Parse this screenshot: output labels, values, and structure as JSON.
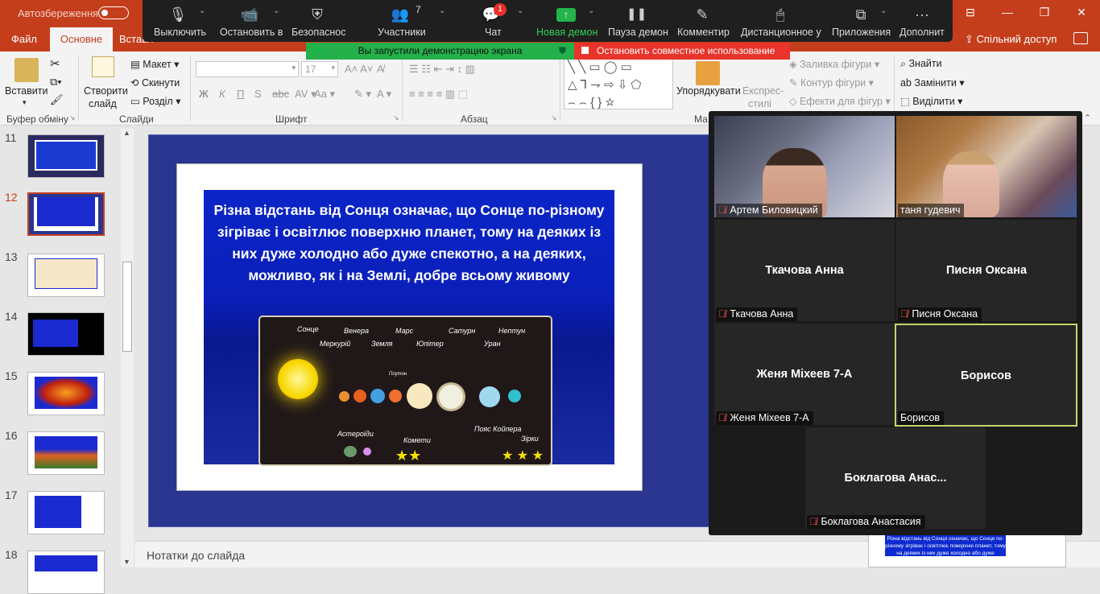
{
  "titlebar": {
    "autosave_label": "Автозбереження"
  },
  "tabs": {
    "file": "Файл",
    "home": "Основне",
    "insert": "Вставл",
    "share": "Спільний доступ"
  },
  "ribbon": {
    "paste": "Вставити",
    "new_slide_1": "Створити",
    "new_slide_2": "слайд",
    "layout": "Макет",
    "reset": "Скинути",
    "section": "Розділ",
    "font_size": "17",
    "arrange": "Упорядкувати",
    "quick_styles_1": "Експрес-",
    "quick_styles_2": "стилі",
    "shape_fill": "Заливка фігури",
    "shape_outline": "Контур фігури",
    "shape_effects": "Ефекти для фігур",
    "find": "Знайти",
    "replace": "Замінити",
    "select": "Виділити",
    "groups": {
      "clipboard": "Буфер обміну",
      "slides": "Слайди",
      "font": "Шрифт",
      "paragraph": "Абзац",
      "drawing": "Ма"
    }
  },
  "zoom": {
    "mute": "Выключить",
    "video": "Остановить в",
    "security": "Безопаснос",
    "participants": "Участники",
    "participants_count": "7",
    "chat": "Чат",
    "chat_badge": "1",
    "new_share": "Новая демон",
    "pause": "Пауза демон",
    "annotate": "Комментир",
    "remote": "Дистанционное у",
    "apps": "Приложения",
    "more": "Дополнит",
    "banner_sharing": "Вы запустили демонстрацию экрана",
    "banner_stop": "Остановить совместное использование"
  },
  "thumbnails": [
    "11",
    "12",
    "13",
    "14",
    "15",
    "16",
    "17",
    "18"
  ],
  "slide": {
    "text": "Різна відстань від Сонця означає, що Сонце по-різному зігріває і освітлює поверхню планет, тому на деяких із них дуже холодно або дуже спекотно, а на деяких, можливо, як і на Землі, добре всьому живому",
    "planets": [
      "Сонце",
      "Венера",
      "Меркурій",
      "Земля",
      "Марс",
      "Юпітер",
      "Сатурн",
      "Уран",
      "Нептун",
      "Плутон",
      "Астероїди",
      "Комети",
      "Пояс Койпера",
      "Зірки"
    ]
  },
  "notes": {
    "label": "Нотатки до слайда"
  },
  "mini_text": "Різна відстань від Сонця означає, що Сонце по-різному зігріває і освітлює поверхню планет, тому на деяких із них дуже холодно або дуже",
  "participants": [
    {
      "label": "Артем Биловицкий",
      "muted": true
    },
    {
      "label": "таня гудевич",
      "muted": false
    },
    {
      "name": "Ткачова Анна",
      "label": "Ткачова Анна",
      "muted": true
    },
    {
      "name": "Писня Оксана",
      "label": "Писня Оксана",
      "muted": true
    },
    {
      "name": "Женя Міхеев 7-А",
      "label": "Женя Міхеев 7-А",
      "muted": true
    },
    {
      "name": "Борисов",
      "label": "Борисов",
      "muted": false
    },
    {
      "name": "Боклагова  Анас...",
      "label": "Боклагова Анастасия",
      "muted": true
    }
  ]
}
